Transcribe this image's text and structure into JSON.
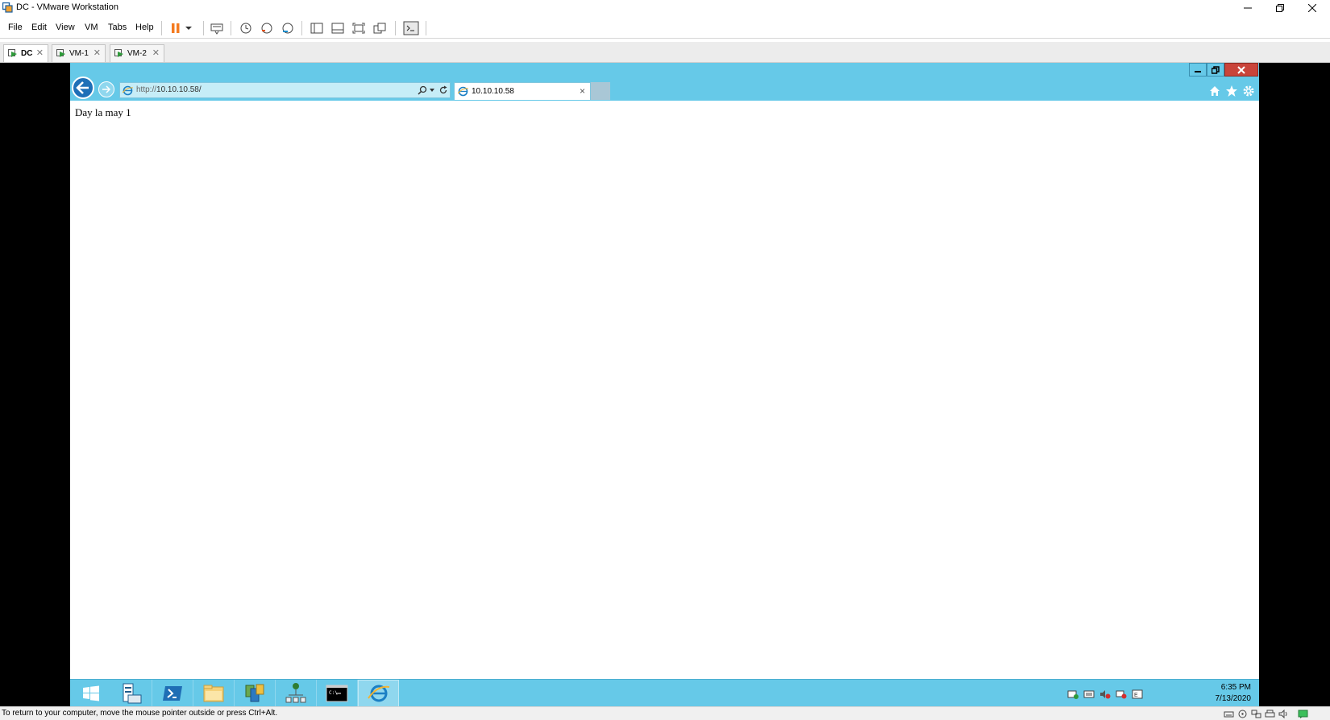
{
  "window": {
    "title": "DC - VMware Workstation",
    "minimize": "—",
    "restore": "❐",
    "close": "✕"
  },
  "menu": {
    "items": [
      "File",
      "Edit",
      "View",
      "VM",
      "Tabs",
      "Help"
    ]
  },
  "vm_tabs": [
    {
      "label": "DC",
      "active": true,
      "close": "✕"
    },
    {
      "label": "VM-1",
      "active": false,
      "close": "✕"
    },
    {
      "label": "VM-2",
      "active": false,
      "close": "✕"
    }
  ],
  "ie": {
    "address": {
      "prefix": "http://",
      "host": "10.10.10.58/"
    },
    "tab_title": "10.10.10.58",
    "tab_close": "×",
    "page_text": "Day la may 1",
    "win_min": "▁",
    "win_restore": "❐",
    "win_close": "✕"
  },
  "taskbar": {
    "time": "6:35 PM",
    "date": "7/13/2020"
  },
  "statusbar": {
    "message": "To return to your computer, move the mouse pointer outside or press Ctrl+Alt."
  },
  "colors": {
    "ie_accent": "#66c9e8",
    "ie_back": "#1e6fb7",
    "pause_orange": "#f47b20",
    "ie_close_red": "#c9443a"
  }
}
